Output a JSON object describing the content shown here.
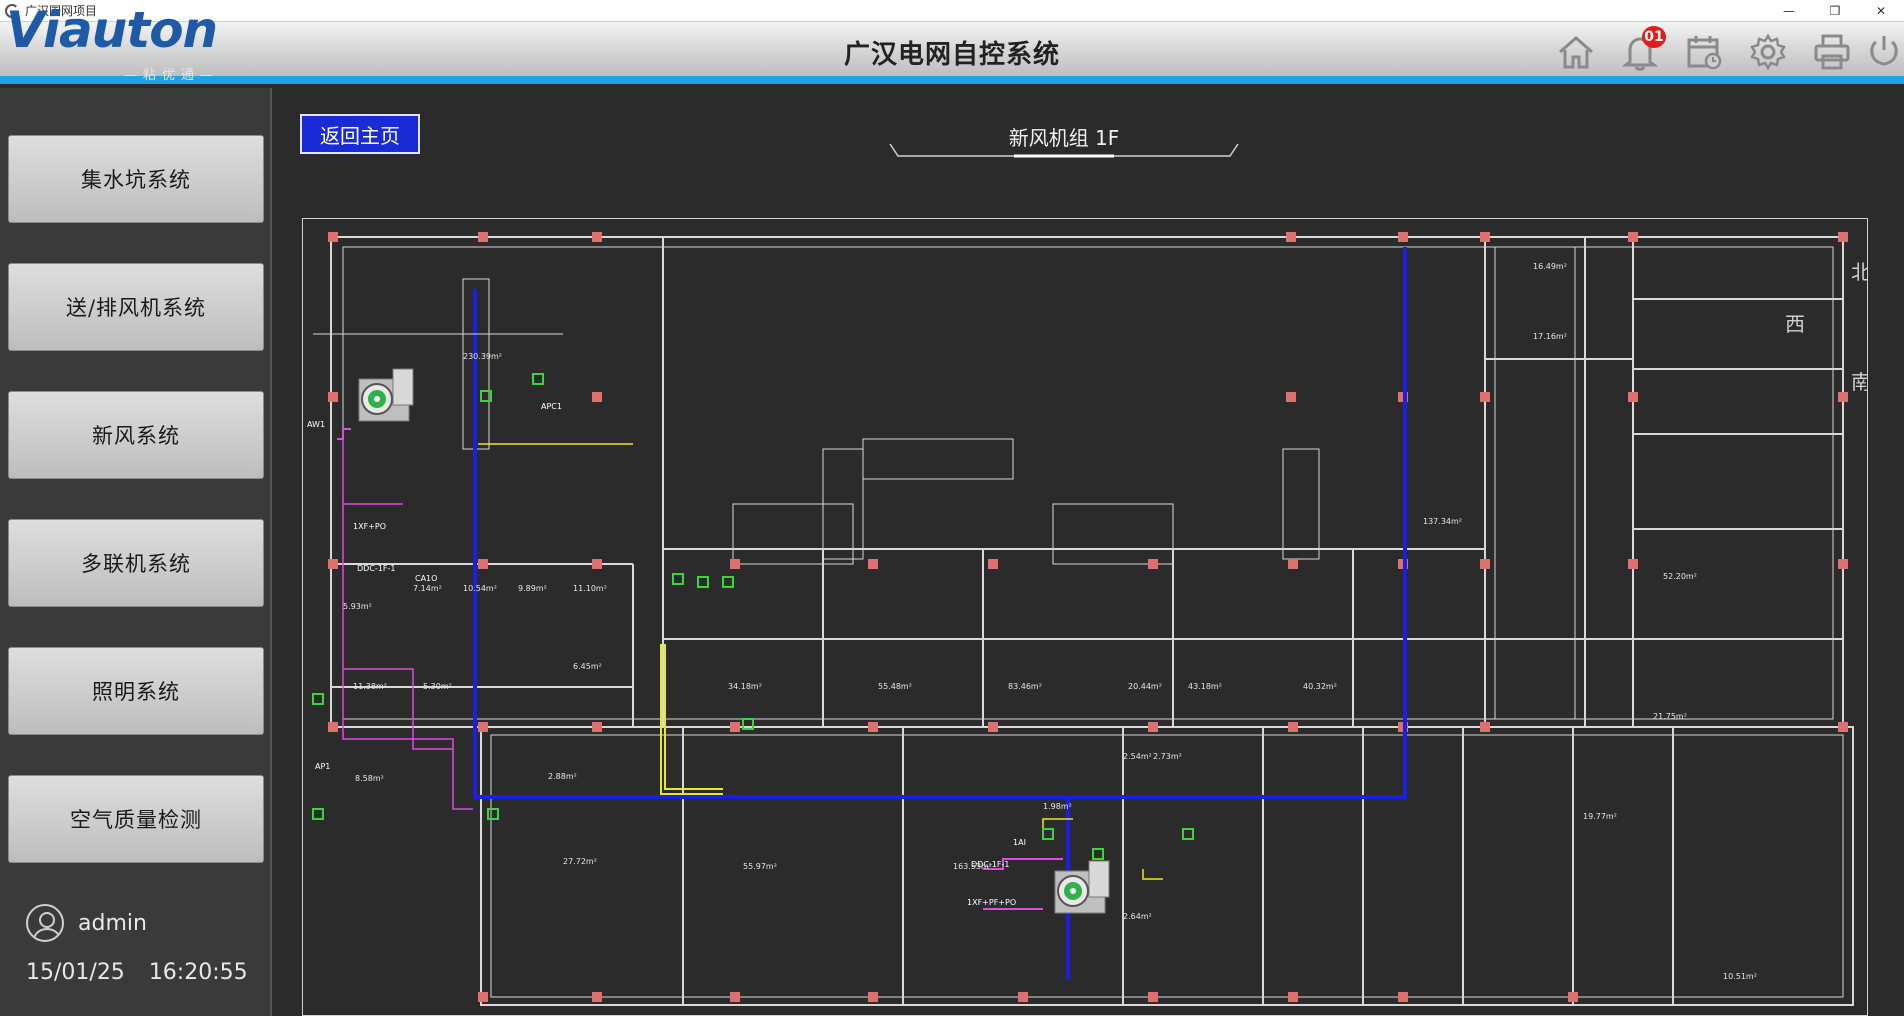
{
  "window": {
    "title": "广汉国网项目",
    "minimize": "—",
    "restore": "❐",
    "close": "✕"
  },
  "header": {
    "logo_text": "Viauton",
    "logo_sub": "—粘优通—",
    "title": "广汉电网自控系统",
    "notification_count": "01"
  },
  "sidebar": {
    "items": [
      {
        "label": "集水坑系统"
      },
      {
        "label": "送/排风机系统"
      },
      {
        "label": "新风系统"
      },
      {
        "label": "多联机系统"
      },
      {
        "label": "照明系统"
      },
      {
        "label": "空气质量检测"
      }
    ],
    "user": "admin",
    "date": "15/01/25",
    "time": "16:20:55"
  },
  "main": {
    "back_label": "返回主页",
    "page_title": "新风机组 1F"
  },
  "plan": {
    "equipment_labels": [
      "AW1",
      "1XF+PO",
      "DDC-1F-1",
      "CA1O",
      "APC1",
      "AP1",
      "DDC-1F-1",
      "1XF+PF+PO",
      "1AI"
    ],
    "room_labels": [
      {
        "name": "",
        "area": "230.39m²"
      },
      {
        "name": "",
        "area": "5.93m²"
      },
      {
        "name": "",
        "area": "7.14m²"
      },
      {
        "name": "",
        "area": "10.54m²"
      },
      {
        "name": "",
        "area": "9.89m²"
      },
      {
        "name": "",
        "area": "11.10m²"
      },
      {
        "name": "",
        "area": "11.38m²"
      },
      {
        "name": "",
        "area": "5.30m²"
      },
      {
        "name": "",
        "area": "6.45m²"
      },
      {
        "name": "",
        "area": "8.58m²"
      },
      {
        "name": "",
        "area": "2.88m²"
      },
      {
        "name": "",
        "area": "34.18m²"
      },
      {
        "name": "",
        "area": "55.48m²"
      },
      {
        "name": "",
        "area": "83.46m²"
      },
      {
        "name": "",
        "area": "20.44m²"
      },
      {
        "name": "",
        "area": "43.18m²"
      },
      {
        "name": "",
        "area": "40.32m²"
      },
      {
        "name": "",
        "area": "137.34m²"
      },
      {
        "name": "",
        "area": "16.49m²"
      },
      {
        "name": "",
        "area": "17.16m²"
      },
      {
        "name": "",
        "area": "52.20m²"
      },
      {
        "name": "",
        "area": "21.75m²"
      },
      {
        "name": "",
        "area": "27.72m²"
      },
      {
        "name": "",
        "area": "55.97m²"
      },
      {
        "name": "",
        "area": "163.53m²"
      },
      {
        "name": "",
        "area": "19.77m²"
      },
      {
        "name": "",
        "area": "10.51m²"
      },
      {
        "name": "",
        "area": "1.98m²"
      },
      {
        "name": "",
        "area": "2.64m²"
      },
      {
        "name": "",
        "area": "2.54m²"
      },
      {
        "name": "",
        "area": "2.73m²"
      }
    ],
    "compass": [
      "北",
      "西",
      "南"
    ],
    "colors": {
      "duct": "#1a1fe0",
      "supply": "#e04be0",
      "signal": "#e8e82a",
      "column": "#e07070",
      "wall": "#d8d8d8",
      "device": "#3fd23f"
    }
  }
}
